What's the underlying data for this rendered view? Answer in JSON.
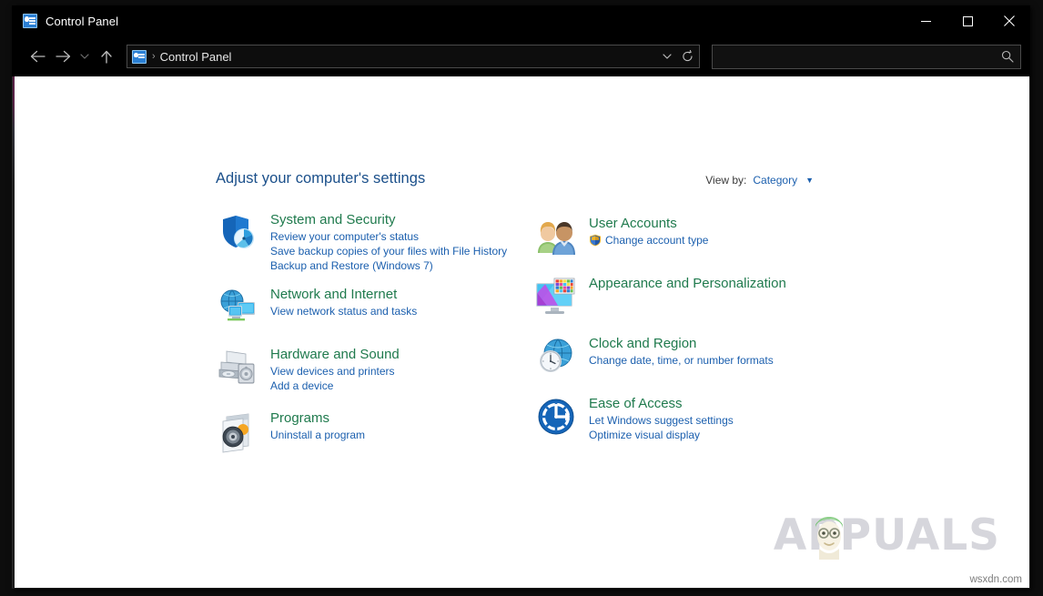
{
  "window": {
    "title": "Control Panel",
    "title_icon": "control-panel-icon",
    "controls": {
      "minimize": "minimize-icon",
      "maximize": "maximize-icon",
      "close": "close-icon"
    }
  },
  "navbar": {
    "back": "back-arrow-icon",
    "forward": "forward-arrow-icon",
    "recent": "chevron-down-icon",
    "up": "up-arrow-icon",
    "breadcrumb_icon": "control-panel-icon",
    "breadcrumb_separator": "›",
    "breadcrumb_text": "Control Panel",
    "dropdown": "chevron-down-icon",
    "refresh": "refresh-icon",
    "search": {
      "value": "",
      "placeholder": "",
      "icon": "search-icon"
    }
  },
  "main": {
    "page_title": "Adjust your computer's settings",
    "view_by": {
      "label": "View by:",
      "value": "Category",
      "caret": "▼"
    }
  },
  "categories_left": [
    {
      "icon": "shield-performance-icon",
      "title": "System and Security",
      "links": [
        "Review your computer's status",
        "Save backup copies of your files with File History",
        "Backup and Restore (Windows 7)"
      ]
    },
    {
      "icon": "network-globe-monitor-icon",
      "title": "Network and Internet",
      "links": [
        "View network status and tasks"
      ]
    },
    {
      "icon": "printer-speaker-icon",
      "title": "Hardware and Sound",
      "links": [
        "View devices and printers",
        "Add a device"
      ]
    },
    {
      "icon": "programs-disc-icon",
      "title": "Programs",
      "links": [
        "Uninstall a program"
      ]
    }
  ],
  "categories_right": [
    {
      "icon": "user-accounts-people-icon",
      "title": "User Accounts",
      "links": [
        "Change account type"
      ],
      "link_shield": "uac-shield-icon"
    },
    {
      "icon": "monitor-palette-icon",
      "title": "Appearance and Personalization",
      "links": []
    },
    {
      "icon": "clock-globe-icon",
      "title": "Clock and Region",
      "links": [
        "Change date, time, or number formats"
      ]
    },
    {
      "icon": "ease-of-access-icon",
      "title": "Ease of Access",
      "links": [
        "Let Windows suggest settings",
        "Optimize visual display"
      ]
    }
  ],
  "watermark": {
    "text": "APPUALS",
    "mascot": "appuals-mascot-icon",
    "site": "wsxdn.com"
  },
  "colors": {
    "title_bar_bg": "#000000",
    "content_bg": "#ffffff",
    "category_title": "#1f7a4d",
    "link": "#1b5fae",
    "page_title": "#1a4f8a",
    "accent_icon_blue": "#1a6fc4"
  }
}
